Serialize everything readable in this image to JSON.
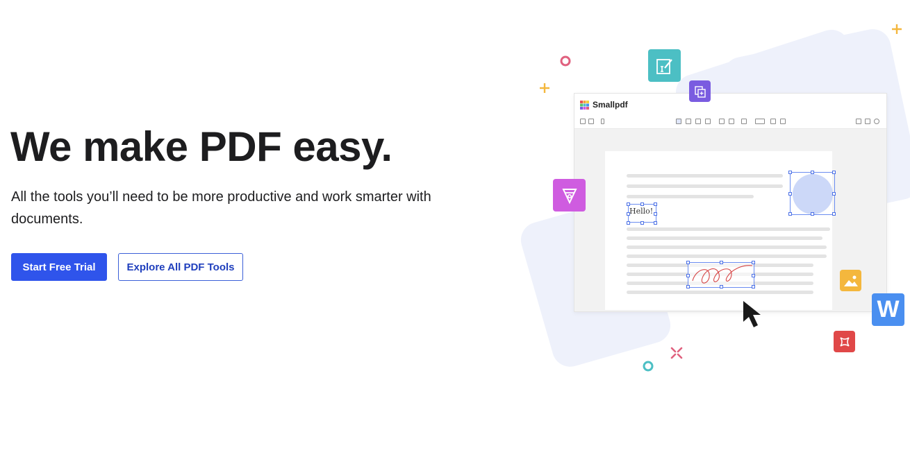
{
  "hero": {
    "title": "We make PDF easy.",
    "subtitle": "All the tools you’ll need to be more productive and work smarter with documents.",
    "primary_cta": "Start Free Trial",
    "secondary_cta": "Explore All PDF Tools"
  },
  "illustration": {
    "app_name": "Smallpdf",
    "hello_text": "Hello!",
    "word_letter": "W",
    "colors": {
      "primary": "#2f54eb",
      "teal": "#4cbfc4",
      "purple": "#7a5ce0",
      "magenta": "#cf5ce0",
      "yellow": "#f4b73d",
      "blue": "#4a8ff0",
      "red": "#e04848",
      "pink": "#e0607e"
    },
    "icons": [
      "edit-document-icon",
      "copy-pages-icon",
      "pen-nib-icon",
      "image-icon",
      "word-icon",
      "crop-icon",
      "cursor-icon"
    ]
  }
}
